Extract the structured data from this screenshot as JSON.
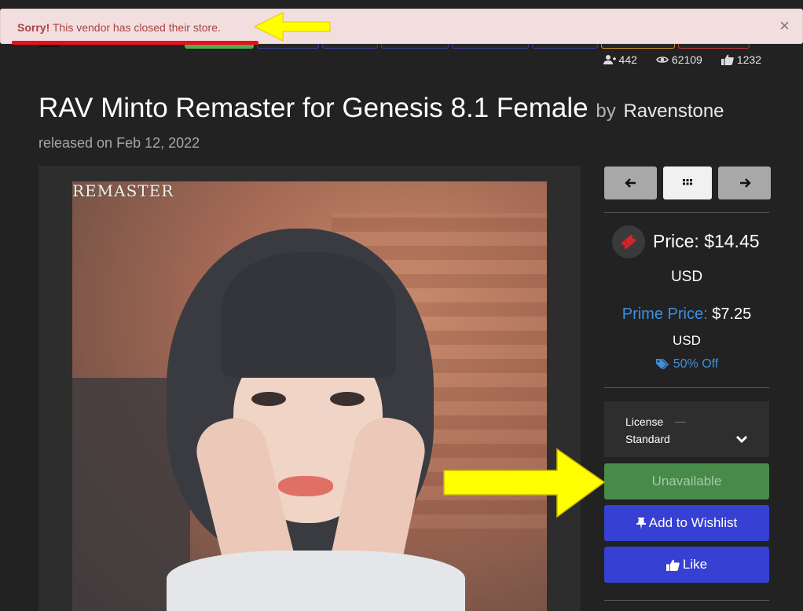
{
  "alert": {
    "strong": "Sorry!",
    "message": " This vendor has closed their store.",
    "close_glyph": "×"
  },
  "stats": {
    "followers": "442",
    "views": "62109",
    "likes": "1232"
  },
  "product": {
    "title": "RAV Minto Remaster for Genesis 8.1 Female",
    "by": "by",
    "vendor": "Ravenstone",
    "released": "released on Feb 12, 2022",
    "image_overlay_text": "REMASTER"
  },
  "pricing": {
    "price_label": "Price:",
    "price_value": "$14.45",
    "price_currency": "USD",
    "prime_label": "Prime Price:",
    "prime_value": "$7.25",
    "prime_currency": "USD",
    "discount": "50% Off"
  },
  "license": {
    "label": "License",
    "value": "Standard"
  },
  "buttons": {
    "unavailable": "Unavailable",
    "wishlist": "Add to Wishlist",
    "like": "Like"
  },
  "colors": {
    "alert_bg": "#f2dede",
    "alert_text": "#a94442",
    "annotation_arrow": "#ffff00",
    "annotation_underline": "#e8101a",
    "prime_blue": "#3d8fe0",
    "button_blue": "#3640d2",
    "button_green": "#478a4a"
  },
  "icons": {
    "followers": "user-plus-icon",
    "views": "eye-icon",
    "likes": "thumbs-up-icon",
    "prev": "arrow-left-icon",
    "grid": "grid-icon",
    "next": "arrow-right-icon",
    "price": "ticket-icon",
    "discount": "tags-icon",
    "license": "chevron-down-icon",
    "wishlist": "pin-icon",
    "like": "thumbs-up-icon"
  }
}
